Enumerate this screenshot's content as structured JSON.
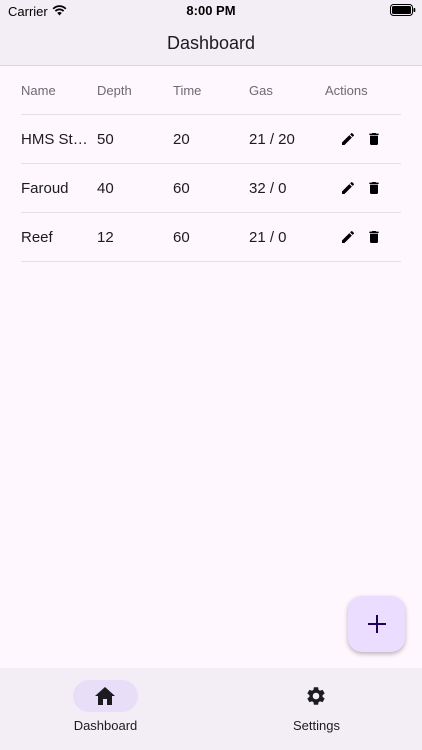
{
  "status_bar": {
    "carrier": "Carrier",
    "time": "8:00 PM",
    "icons": [
      "wifi-icon",
      "battery-icon"
    ]
  },
  "app_bar": {
    "title": "Dashboard"
  },
  "table": {
    "columns": [
      "Name",
      "Depth",
      "Time",
      "Gas",
      "Actions"
    ],
    "rows": [
      {
        "name": "HMS Stu...",
        "depth": "50",
        "time": "20",
        "gas": "21 / 20"
      },
      {
        "name": "Faroud",
        "depth": "40",
        "time": "60",
        "gas": "32 / 0"
      },
      {
        "name": "Reef",
        "depth": "12",
        "time": "60",
        "gas": "21 / 0"
      }
    ],
    "row_action_icons": [
      "pencil-icon",
      "trash-icon"
    ]
  },
  "fab": {
    "icon": "plus-icon"
  },
  "bottom_nav": {
    "items": [
      {
        "label": "Dashboard",
        "icon": "home-icon",
        "selected": true
      },
      {
        "label": "Settings",
        "icon": "gear-icon",
        "selected": false
      }
    ]
  },
  "colors": {
    "background": "#fef7fd",
    "bar_surface": "#f3eef6",
    "fab_container": "#eaddff",
    "nav_indicator": "#e8def8",
    "text_primary": "#1c1b1f",
    "text_secondary": "#6e6a72"
  }
}
